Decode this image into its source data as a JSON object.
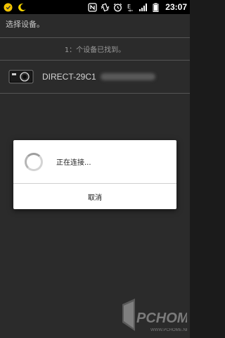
{
  "status_bar": {
    "time": "23:07",
    "left_icons": [
      "android-notification-icon",
      "moon-icon"
    ],
    "right_icons": [
      "nfc-icon",
      "vibrate-icon",
      "alarm-icon",
      "data-e-icon",
      "signal-icon",
      "battery-icon"
    ]
  },
  "screen": {
    "title": "选择设备。",
    "found_label": "1：个设备已找到。",
    "devices": [
      {
        "name": "DIRECT-29C1",
        "icon": "camera-icon"
      }
    ]
  },
  "dialog": {
    "message": "正在连接...",
    "cancel_label": "取消"
  },
  "watermark": {
    "logo": "PCHOME",
    "url": "WWW.PCHOME.NET"
  },
  "colors": {
    "background": "#2b2b2b",
    "status_bar": "#000000",
    "dialog": "#ffffff"
  }
}
